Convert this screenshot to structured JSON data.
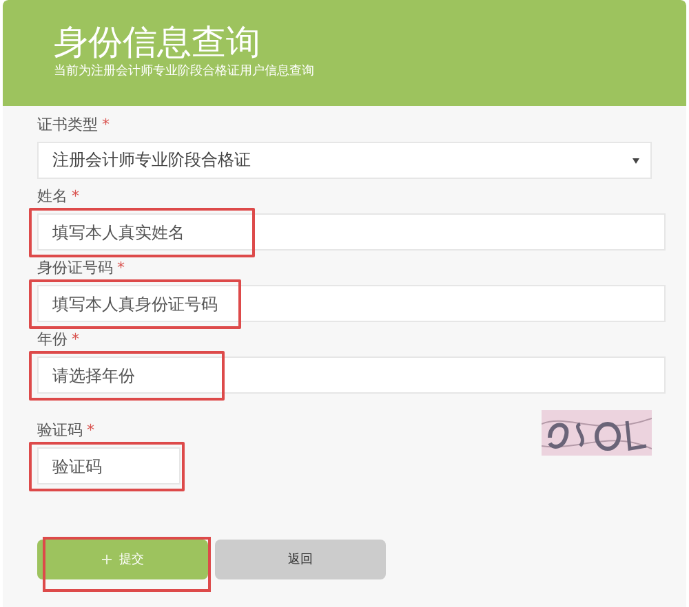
{
  "header": {
    "title": "身份信息查询",
    "subtitle": "当前为注册会计师专业阶段合格证用户信息查询"
  },
  "fields": [
    {
      "kind": "select",
      "label": "证书类型",
      "required_mark": "*",
      "value": "注册会计师专业阶段合格证",
      "highlighted": false
    },
    {
      "kind": "input",
      "label": "姓名",
      "required_mark": "*",
      "placeholder": "填写本人真实姓名",
      "highlighted": true
    },
    {
      "kind": "input",
      "label": "身份证号码",
      "required_mark": "*",
      "placeholder": "填写本人真身份证号码",
      "highlighted": true
    },
    {
      "kind": "input",
      "label": "年份",
      "required_mark": "*",
      "placeholder": "请选择年份",
      "highlighted": true
    },
    {
      "kind": "captcha",
      "label": "验证码",
      "required_mark": "*",
      "placeholder": "验证码",
      "highlighted": true
    }
  ],
  "buttons": [
    {
      "kind": "primary",
      "label": "提交",
      "highlighted": true
    },
    {
      "kind": "secondary",
      "label": "返回",
      "highlighted": false
    }
  ]
}
